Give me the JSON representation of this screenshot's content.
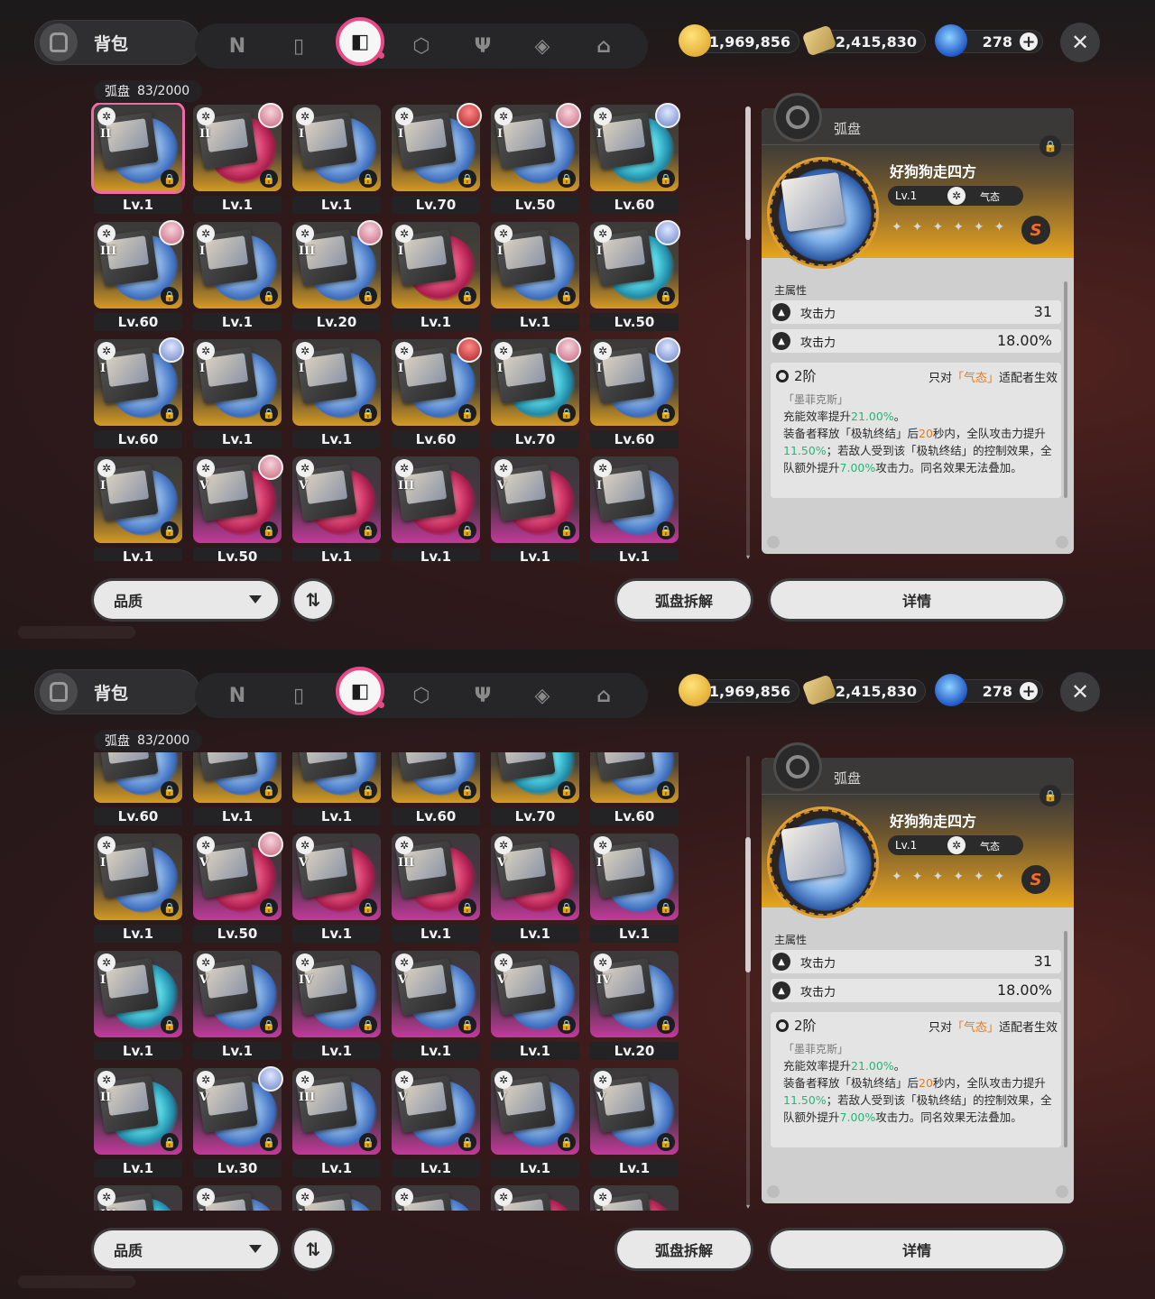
{
  "header": {
    "title": "背包",
    "tabs": [
      {
        "icon": "n-logo-icon",
        "glyph": "N"
      },
      {
        "icon": "gameboy-icon",
        "glyph": "▯"
      },
      {
        "icon": "disc-folder-icon",
        "glyph": "◧",
        "active": true
      },
      {
        "icon": "cube-icon",
        "glyph": "⬡"
      },
      {
        "icon": "food-icon",
        "glyph": "Ψ"
      },
      {
        "icon": "cube-tilt-icon",
        "glyph": "◈"
      },
      {
        "icon": "home-icon",
        "glyph": "⌂"
      }
    ],
    "currencies": {
      "denny": "1,969,856",
      "ticket": "2,415,830",
      "polychrome": "278"
    },
    "close_label": "✕"
  },
  "inventory": {
    "label": "弧盘",
    "count": "83/2000"
  },
  "view1": {
    "rows": [
      [
        {
          "lv": "Lv.1",
          "rank": "II",
          "q": "gold",
          "disc": "blue",
          "sel": true
        },
        {
          "lv": "Lv.1",
          "rank": "II",
          "q": "gold",
          "disc": "red",
          "av": "pink"
        },
        {
          "lv": "Lv.1",
          "rank": "I",
          "q": "gold",
          "disc": "blue"
        },
        {
          "lv": "Lv.70",
          "rank": "I",
          "q": "gold",
          "disc": "blue",
          "av": "red"
        },
        {
          "lv": "Lv.50",
          "rank": "I",
          "q": "gold",
          "disc": "blue",
          "av": "pink"
        },
        {
          "lv": "Lv.60",
          "rank": "I",
          "q": "gold",
          "disc": "teal",
          "av": "blue"
        }
      ],
      [
        {
          "lv": "Lv.60",
          "rank": "III",
          "q": "gold",
          "disc": "blue",
          "av": "pink"
        },
        {
          "lv": "Lv.1",
          "rank": "I",
          "q": "gold",
          "disc": "blue"
        },
        {
          "lv": "Lv.20",
          "rank": "III",
          "q": "gold",
          "disc": "blue",
          "av": "pink"
        },
        {
          "lv": "Lv.1",
          "rank": "I",
          "q": "gold",
          "disc": "red"
        },
        {
          "lv": "Lv.1",
          "rank": "I",
          "q": "gold",
          "disc": "blue"
        },
        {
          "lv": "Lv.50",
          "rank": "I",
          "q": "gold",
          "disc": "teal",
          "av": "blue"
        }
      ],
      [
        {
          "lv": "Lv.60",
          "rank": "I",
          "q": "gold",
          "disc": "blue",
          "av": "blue"
        },
        {
          "lv": "Lv.1",
          "rank": "I",
          "q": "gold",
          "disc": "blue"
        },
        {
          "lv": "Lv.1",
          "rank": "I",
          "q": "gold",
          "disc": "blue"
        },
        {
          "lv": "Lv.60",
          "rank": "I",
          "q": "gold",
          "disc": "blue",
          "av": "red"
        },
        {
          "lv": "Lv.70",
          "rank": "I",
          "q": "gold",
          "disc": "teal",
          "av": "pink"
        },
        {
          "lv": "Lv.60",
          "rank": "I",
          "q": "gold",
          "disc": "blue",
          "av": "blue"
        }
      ],
      [
        {
          "lv": "Lv.1",
          "rank": "I",
          "q": "gold",
          "disc": "blue"
        },
        {
          "lv": "Lv.50",
          "rank": "V",
          "q": "purple",
          "disc": "red",
          "av": "pink"
        },
        {
          "lv": "Lv.1",
          "rank": "V",
          "q": "purple",
          "disc": "red"
        },
        {
          "lv": "Lv.1",
          "rank": "III",
          "q": "purple",
          "disc": "red"
        },
        {
          "lv": "Lv.1",
          "rank": "V",
          "q": "purple",
          "disc": "red"
        },
        {
          "lv": "Lv.1",
          "rank": "I",
          "q": "purple",
          "disc": "blue"
        }
      ]
    ]
  },
  "view2": {
    "rows": [
      [
        {
          "lv": "Lv.60",
          "rank": "",
          "q": "gold",
          "disc": "blue"
        },
        {
          "lv": "Lv.1",
          "rank": "",
          "q": "gold",
          "disc": "blue"
        },
        {
          "lv": "Lv.1",
          "rank": "",
          "q": "gold",
          "disc": "blue"
        },
        {
          "lv": "Lv.60",
          "rank": "",
          "q": "gold",
          "disc": "blue"
        },
        {
          "lv": "Lv.70",
          "rank": "",
          "q": "gold",
          "disc": "teal"
        },
        {
          "lv": "Lv.60",
          "rank": "",
          "q": "gold",
          "disc": "blue"
        }
      ],
      [
        {
          "lv": "Lv.1",
          "rank": "I",
          "q": "gold",
          "disc": "blue"
        },
        {
          "lv": "Lv.50",
          "rank": "V",
          "q": "purple",
          "disc": "red",
          "av": "pink"
        },
        {
          "lv": "Lv.1",
          "rank": "V",
          "q": "purple",
          "disc": "red"
        },
        {
          "lv": "Lv.1",
          "rank": "III",
          "q": "purple",
          "disc": "red"
        },
        {
          "lv": "Lv.1",
          "rank": "V",
          "q": "purple",
          "disc": "red"
        },
        {
          "lv": "Lv.1",
          "rank": "I",
          "q": "purple",
          "disc": "blue"
        }
      ],
      [
        {
          "lv": "Lv.1",
          "rank": "I",
          "q": "purple",
          "disc": "teal"
        },
        {
          "lv": "Lv.1",
          "rank": "V",
          "q": "purple",
          "disc": "blue"
        },
        {
          "lv": "Lv.1",
          "rank": "IV",
          "q": "purple",
          "disc": "blue"
        },
        {
          "lv": "Lv.1",
          "rank": "V",
          "q": "purple",
          "disc": "blue"
        },
        {
          "lv": "Lv.1",
          "rank": "V",
          "q": "purple",
          "disc": "blue"
        },
        {
          "lv": "Lv.20",
          "rank": "IV",
          "q": "purple",
          "disc": "blue"
        }
      ],
      [
        {
          "lv": "Lv.1",
          "rank": "II",
          "q": "purple",
          "disc": "teal"
        },
        {
          "lv": "Lv.30",
          "rank": "V",
          "q": "purple",
          "disc": "blue",
          "av": "blue"
        },
        {
          "lv": "Lv.1",
          "rank": "III",
          "q": "purple",
          "disc": "blue"
        },
        {
          "lv": "Lv.1",
          "rank": "V",
          "q": "purple",
          "disc": "blue"
        },
        {
          "lv": "Lv.1",
          "rank": "V",
          "q": "purple",
          "disc": "blue"
        },
        {
          "lv": "Lv.1",
          "rank": "V",
          "q": "purple",
          "disc": "blue"
        }
      ],
      [
        {
          "lv": "",
          "rank": "III",
          "q": "purple",
          "disc": "teal"
        },
        {
          "lv": "",
          "rank": "V",
          "q": "purple",
          "disc": "blue"
        },
        {
          "lv": "",
          "rank": "V",
          "q": "purple",
          "disc": "blue"
        },
        {
          "lv": "",
          "rank": "V",
          "q": "purple",
          "disc": "blue"
        },
        {
          "lv": "",
          "rank": "I",
          "q": "purple",
          "disc": "red"
        },
        {
          "lv": "",
          "rank": "V",
          "q": "purple",
          "disc": "red"
        }
      ]
    ]
  },
  "detail": {
    "category": "弧盘",
    "name": "好狗狗走四方",
    "level": "Lv.1",
    "attribute": "气态",
    "rank_badge": "S",
    "main_stat_label": "主属性",
    "stats": [
      {
        "name": "攻击力",
        "value": "31"
      },
      {
        "name": "攻击力",
        "value": "18.00%"
      }
    ],
    "set": {
      "tier": "2阶",
      "req_prefix": "只对",
      "req_attr": "「气态」",
      "req_suffix": "适配者生效",
      "title": "「墨菲克斯」",
      "line1_a": "充能效率提升",
      "line1_b": "21.00%",
      "line1_c": "。",
      "line2_a": "装备者释放「极轨终结」后",
      "line2_b": "20",
      "line2_c": "秒内，全队攻击力提升",
      "line2_d": "11.50%",
      "line2_e": "；若敌人受到该「极轨终结」的控制效果，全队额外提升",
      "line2_f": "7.00%",
      "line2_g": "攻击力。同名效果无法叠加。"
    }
  },
  "footer": {
    "filter_label": "品质",
    "sort_icon": "⇅",
    "dismantle_label": "弧盘拆解",
    "details_label": "详情"
  }
}
